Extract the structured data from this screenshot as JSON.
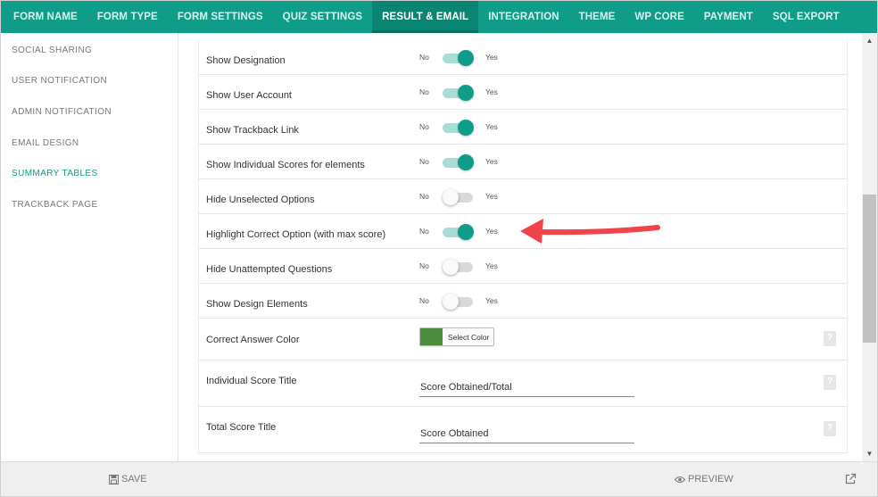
{
  "top_tabs": [
    {
      "label": "FORM NAME"
    },
    {
      "label": "FORM TYPE"
    },
    {
      "label": "FORM SETTINGS"
    },
    {
      "label": "QUIZ SETTINGS"
    },
    {
      "label": "RESULT & EMAIL",
      "active": true
    },
    {
      "label": "INTEGRATION"
    },
    {
      "label": "THEME"
    },
    {
      "label": "WP CORE"
    },
    {
      "label": "PAYMENT"
    },
    {
      "label": "SQL EXPORT"
    }
  ],
  "sidebar": {
    "items": [
      {
        "label": "SOCIAL SHARING"
      },
      {
        "label": "USER NOTIFICATION"
      },
      {
        "label": "ADMIN NOTIFICATION"
      },
      {
        "label": "EMAIL DESIGN"
      },
      {
        "label": "SUMMARY TABLES",
        "active": true
      },
      {
        "label": "TRACKBACK PAGE"
      }
    ]
  },
  "settings": {
    "no_label": "No",
    "yes_label": "Yes",
    "toggles": [
      {
        "label": "Show Designation",
        "on": true
      },
      {
        "label": "Show User Account",
        "on": true
      },
      {
        "label": "Show Trackback Link",
        "on": true
      },
      {
        "label": "Show Individual Scores for elements",
        "on": true
      },
      {
        "label": "Hide Unselected Options",
        "on": false
      },
      {
        "label": "Highlight Correct Option (with max score)",
        "on": true
      },
      {
        "label": "Hide Unattempted Questions",
        "on": false
      },
      {
        "label": "Show Design Elements",
        "on": false
      }
    ],
    "correct_answer_color": {
      "label": "Correct Answer Color",
      "button_label": "Select Color",
      "color": "#4c8c3d"
    },
    "individual_score_title": {
      "label": "Individual Score Title",
      "value": "Score Obtained/Total"
    },
    "total_score_title": {
      "label": "Total Score Title",
      "value": "Score Obtained"
    }
  },
  "bottom": {
    "save_label": "SAVE",
    "preview_label": "PREVIEW"
  },
  "colors": {
    "accent": "#0f9d89",
    "accent_dark": "#0a8473",
    "annotation_arrow": "#f0434a"
  }
}
